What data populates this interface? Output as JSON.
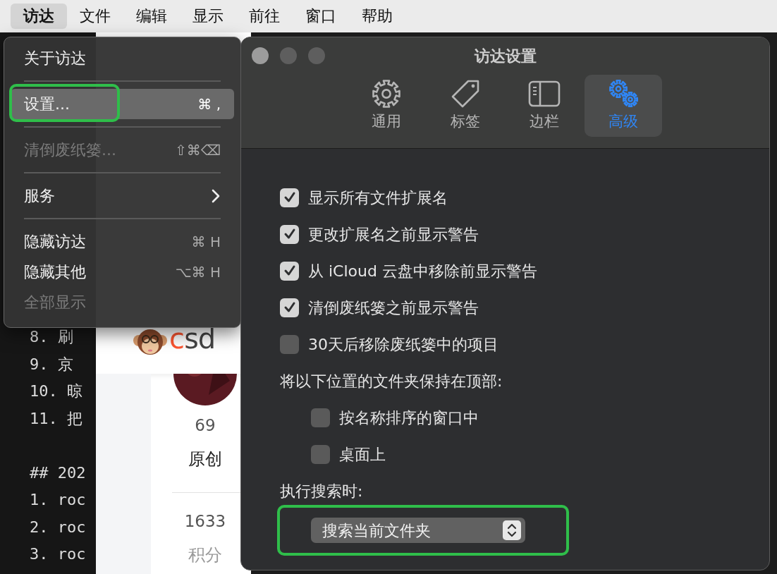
{
  "menu_bar": {
    "items": [
      {
        "label": "访达",
        "selected": true
      },
      {
        "label": "文件",
        "selected": false
      },
      {
        "label": "编辑",
        "selected": false
      },
      {
        "label": "显示",
        "selected": false
      },
      {
        "label": "前往",
        "selected": false
      },
      {
        "label": "窗口",
        "selected": false
      },
      {
        "label": "帮助",
        "selected": false
      }
    ]
  },
  "background": {
    "terminal_blocks": [
      [
        "8. 刷",
        "9. 京",
        "10. 晾",
        "11. 把"
      ],
      [
        "## 202",
        "1. roc",
        "2. roc",
        "3. roc"
      ]
    ],
    "web_page": {
      "logo_text": "csd",
      "stats": [
        {
          "value": "69",
          "label": "原创"
        },
        {
          "value": "1633",
          "label": "积分"
        }
      ]
    }
  },
  "menu": {
    "items": [
      {
        "kind": "item",
        "label": "关于访达",
        "selected": false,
        "disabled": false,
        "highlighted": false
      },
      {
        "kind": "separator"
      },
      {
        "kind": "item",
        "label": "设置...",
        "shortcut": "⌘ ,",
        "selected": true,
        "disabled": false,
        "highlighted": true
      },
      {
        "kind": "separator"
      },
      {
        "kind": "item",
        "label": "清倒废纸篓...",
        "shortcut": "⇧⌘⌫",
        "selected": false,
        "disabled": true,
        "highlighted": false
      },
      {
        "kind": "separator"
      },
      {
        "kind": "submenu",
        "label": "服务",
        "selected": false,
        "disabled": false,
        "highlighted": false
      },
      {
        "kind": "separator"
      },
      {
        "kind": "item",
        "label": "隐藏访达",
        "shortcut": "⌘ H",
        "selected": false,
        "disabled": false,
        "highlighted": false
      },
      {
        "kind": "item",
        "label": "隐藏其他",
        "shortcut": "⌥⌘ H",
        "selected": false,
        "disabled": false,
        "highlighted": false
      },
      {
        "kind": "item",
        "label": "全部显示",
        "selected": false,
        "disabled": true,
        "highlighted": false
      }
    ]
  },
  "window": {
    "title": "访达设置",
    "tabs": [
      {
        "kind": "gear",
        "label": "通用",
        "selected": false
      },
      {
        "kind": "tag",
        "label": "标签",
        "selected": false
      },
      {
        "kind": "sidebar",
        "label": "边栏",
        "selected": false
      },
      {
        "kind": "gears",
        "label": "高级",
        "selected": true
      }
    ],
    "items": [
      {
        "kind": "checkbox",
        "label": "显示所有文件扩展名",
        "checked": true
      },
      {
        "kind": "checkbox",
        "label": "更改扩展名之前显示警告",
        "checked": true
      },
      {
        "kind": "checkbox",
        "label": "从 iCloud 云盘中移除前显示警告",
        "checked": true
      },
      {
        "kind": "checkbox",
        "label": "清倒废纸篓之前显示警告",
        "checked": true
      },
      {
        "kind": "checkbox",
        "label": "30天后移除废纸篓中的项目",
        "checked": false
      },
      {
        "kind": "heading",
        "label": "将以下位置的文件夹保持在顶部:",
        "children": [
          {
            "kind": "checkbox",
            "label": "按名称排序的窗口中",
            "checked": false
          },
          {
            "kind": "checkbox",
            "label": "桌面上",
            "checked": false
          }
        ]
      },
      {
        "kind": "heading",
        "label": "执行搜索时:",
        "children": [
          {
            "kind": "popup",
            "value": "搜索当前文件夹",
            "highlighted": true
          }
        ]
      }
    ]
  }
}
